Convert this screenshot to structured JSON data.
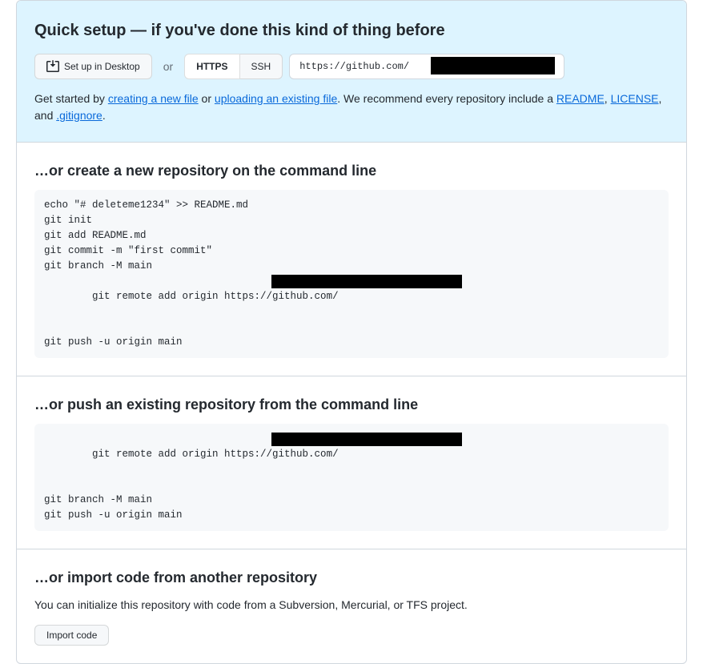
{
  "quickSetup": {
    "title": "Quick setup — if you've done this kind of thing before",
    "desktopBtn": "Set up in Desktop",
    "orText": "or",
    "httpsLabel": "HTTPS",
    "sshLabel": "SSH",
    "urlValue": "https://github.com/",
    "help": {
      "prefix": "Get started by ",
      "link1": "creating a new file",
      "middle1": " or ",
      "link2": "uploading an existing file",
      "middle2": ". We recommend every repository include a ",
      "link3": "README",
      "sep1": ", ",
      "link4": "LICENSE",
      "sep2": ", and ",
      "link5": ".gitignore",
      "end": "."
    }
  },
  "createNew": {
    "title": "…or create a new repository on the command line",
    "lines": [
      "echo \"# deleteme1234\" >> README.md",
      "git init",
      "git add README.md",
      "git commit -m \"first commit\"",
      "git branch -M main",
      "git remote add origin https://github.com/",
      "git push -u origin main"
    ]
  },
  "pushExisting": {
    "title": "…or push an existing repository from the command line",
    "lines": [
      "git remote add origin https://github.com/",
      "git branch -M main",
      "git push -u origin main"
    ]
  },
  "importCode": {
    "title": "…or import code from another repository",
    "description": "You can initialize this repository with code from a Subversion, Mercurial, or TFS project.",
    "button": "Import code"
  }
}
